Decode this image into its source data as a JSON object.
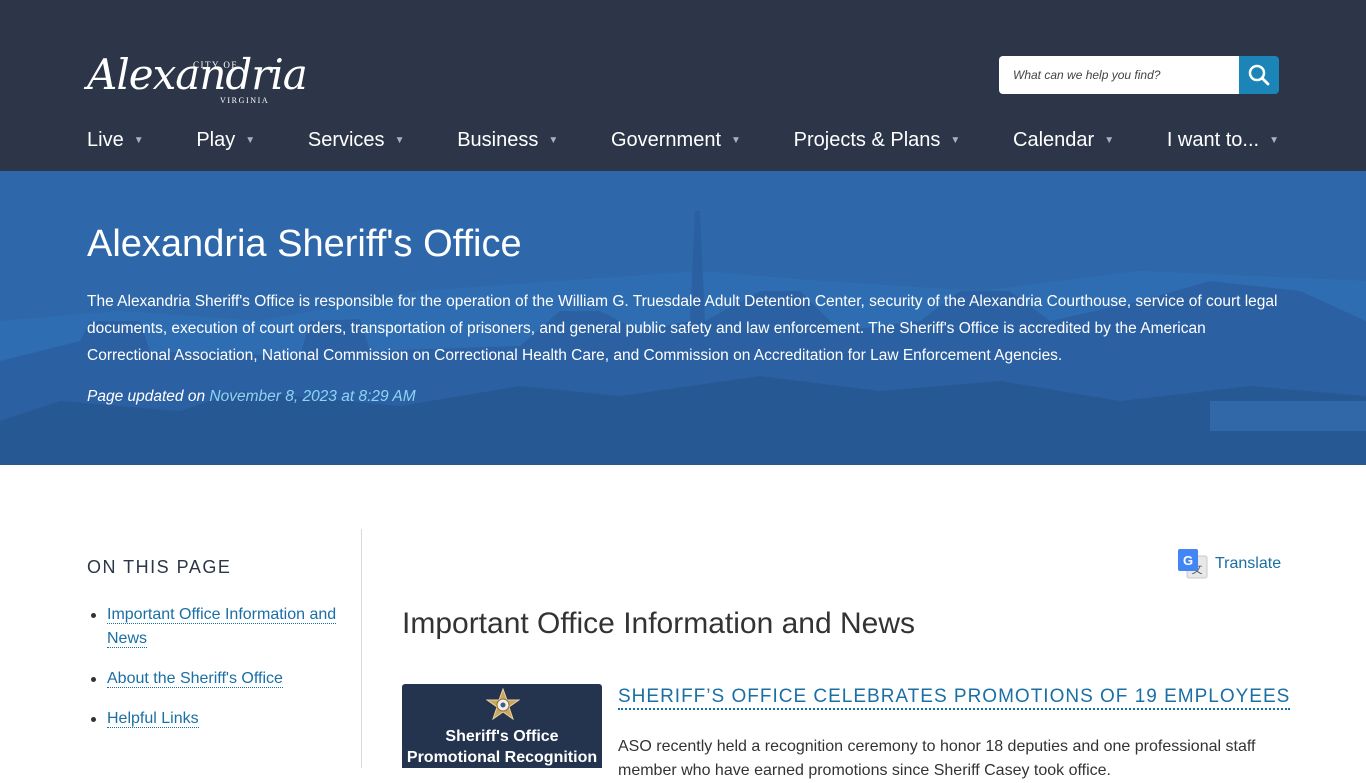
{
  "header": {
    "logo": {
      "city_of": "CITY OF",
      "name": "Alexandria",
      "state": "VIRGINIA"
    },
    "search": {
      "placeholder": "What can we help you find?",
      "icon": "search-icon"
    },
    "nav": [
      {
        "label": "Live"
      },
      {
        "label": "Play"
      },
      {
        "label": "Services"
      },
      {
        "label": "Business"
      },
      {
        "label": "Government"
      },
      {
        "label": "Projects & Plans"
      },
      {
        "label": "Calendar"
      },
      {
        "label": "I want to..."
      }
    ]
  },
  "hero": {
    "title": "Alexandria Sheriff's Office",
    "description": "The Alexandria Sheriff's Office is responsible for the operation of the William G. Truesdale Adult Detention Center, security of the Alexandria Courthouse, service of court legal documents, execution of court orders, transportation of prisoners, and general public safety and law enforcement. The Sheriff's Office is accredited by the American Correctional Association, National Commission on Correctional Health Care, and Commission on Accreditation for Law Enforcement Agencies.",
    "updated_label": "Page updated on",
    "updated_date": "November 8, 2023 at 8:29 AM"
  },
  "sidebar": {
    "heading": "ON THIS PAGE",
    "items": [
      {
        "label": "Important Office Information and News"
      },
      {
        "label": "About the Sheriff's Office"
      },
      {
        "label": "Helpful Links"
      }
    ]
  },
  "main": {
    "translate_label": "Translate",
    "section_title": "Important Office Information and News",
    "news": [
      {
        "image_line1": "Sheriff's Office",
        "image_line2": "Promotional Recognition",
        "title": "SHERIFF’S OFFICE CELEBRATES PROMOTIONS OF 19 EMPLOYEES",
        "text": "ASO recently held a recognition ceremony to honor 18 deputies and one professional staff member who have earned promotions since Sheriff Casey took office."
      }
    ]
  },
  "colors": {
    "header_bg": "#2c3648",
    "hero_bg": "#2f6db2",
    "link": "#1a6fa5",
    "search_button": "#1b85b8",
    "updated_date": "#8fd3f5"
  }
}
